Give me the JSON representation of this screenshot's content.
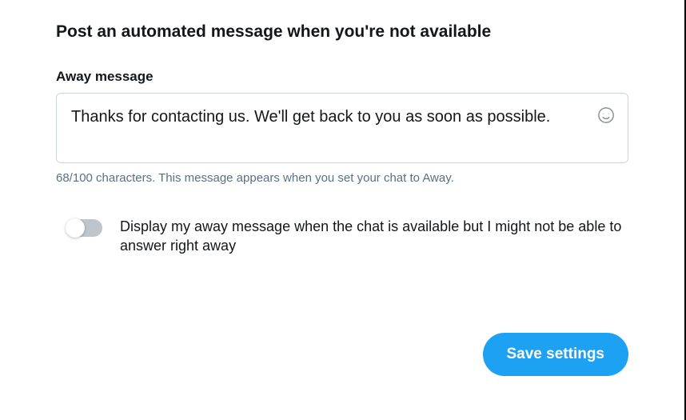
{
  "header": {
    "title": "Post an automated message when you're not available"
  },
  "away_message": {
    "label": "Away message",
    "value": "Thanks for contacting us. We'll get back to you as soon as possible.",
    "char_count_text": "68/100 characters. This message appears when you set your chat to Away."
  },
  "toggle": {
    "label": "Display my away message when the chat is available but I might not be able to answer right away",
    "on": false
  },
  "actions": {
    "save_label": "Save settings"
  },
  "icons": {
    "emoji": "emoji-icon"
  }
}
